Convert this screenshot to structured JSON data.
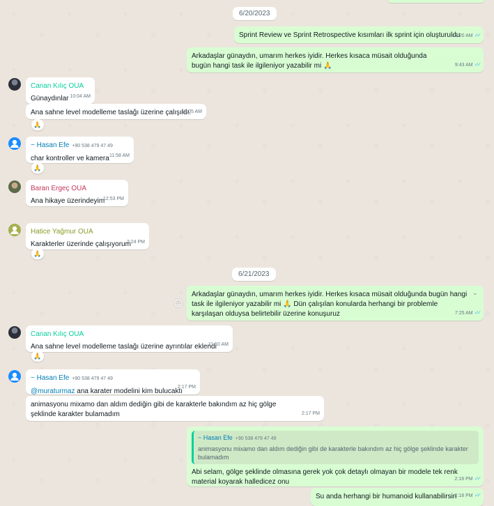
{
  "dates": {
    "d1": "6/20/2023",
    "d2": "6/21/2023"
  },
  "m1": {
    "text": "Sprint Review ve Sprint Retrospective kısımları ilk sprint için oluşturuldu",
    "time": "12:20 AM"
  },
  "m2": {
    "text": "Arkadaşlar günaydın, umarım herkes iyidir. Herkes kısaca müsait olduğunda bugün hangi task ile ilgileniyor yazabilir mi 🙏",
    "time": "9:43 AM"
  },
  "m3": {
    "sender": "Canan Kılıç OUA",
    "text": "Günaydınlar",
    "time": "10:04 AM"
  },
  "m4": {
    "text": "Ana sahne level modelleme taslağı üzerine çalışıldı.",
    "time": "10:05 AM"
  },
  "m5": {
    "sender": "~ Hasan Efe",
    "phone": "+90 538 479 47 49",
    "text": "char kontroller ve kamera",
    "time": "11:58 AM"
  },
  "m6": {
    "sender": "Baran Ergeç OUA",
    "text": "Ana hikaye üzerindeyim",
    "time": "12:53 PM"
  },
  "m7": {
    "sender": "Hatice Yağmur OUA",
    "text": "Karakterler üzerinde çalışıyorum",
    "time": "2:24 PM"
  },
  "m8": {
    "text": "Arkadaşlar günaydın, umarım herkes iyidir. Herkes kısaca müsait olduğunda bugün hangi task ile ilgileniyor yazabilir mi 🙏 Dün çalışılan konularda herhangi bir problemle karşılaşan olduysa belirtebilir üzerine konuşuruz",
    "time": "7:25 AM"
  },
  "m9": {
    "sender": "Canan Kılıç OUA",
    "text": "Ana sahne level modelleme taslağı üzerine ayrıntılar eklendi",
    "time": "11:10 AM"
  },
  "m10": {
    "sender": "~ Hasan Efe",
    "phone": "+90 538 479 47 49",
    "mention": "@muraturmaz",
    "text": " ana karater modelini kim bulucaktı",
    "time": "2:17 PM"
  },
  "m11": {
    "text": "animasyonu mixamo dan aldım dediğin gibi de karakterle bakındım az hiç gölge şeklinde karakter bulamadım",
    "time": "2:17 PM"
  },
  "m12": {
    "quote_sender": "~ Hasan Efe",
    "quote_phone": "+90 538 479 47 49",
    "quote_text": "animasyonu mixamo dan aldım dediğin gibi de karakterle bakındım az hiç gölge şeklinde karakter bulamadım",
    "text": "Abi selam, gölge şeklinde olmasına gerek yok çok detaylı olmayan bir modele tek renk material koyarak halledicez onu",
    "time": "2:18 PM"
  },
  "m13": {
    "text": "Su anda herhangi bir humanoid kullanabilirsin",
    "time": "2:18 PM"
  },
  "reaction": "🙏",
  "colors": {
    "canan": "#06cf9c",
    "hasan": "#027eb5",
    "baran": "#c4375b",
    "hatice": "#8a9a28",
    "out_bubble": "#d9fdd3",
    "ticks": "#53bdeb"
  }
}
